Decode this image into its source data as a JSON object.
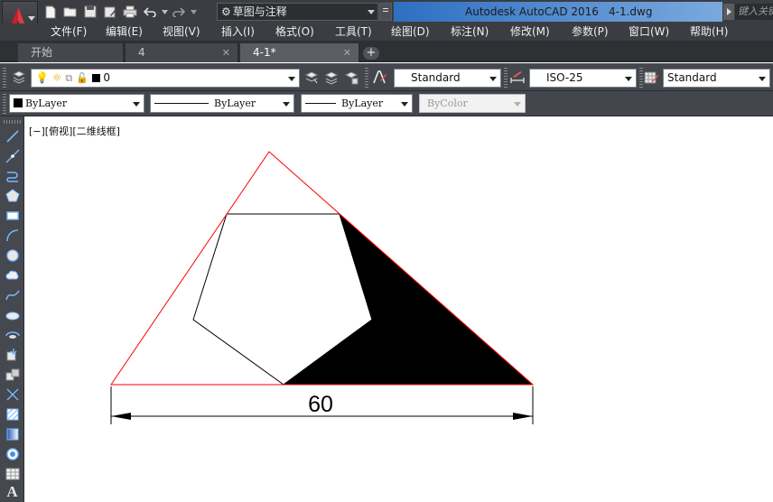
{
  "titlebar": {
    "app_button_icon": "autocad-logo-icon",
    "quick_access": [
      "new-file-icon",
      "open-folder-icon",
      "save-icon",
      "save-as-icon",
      "print-icon",
      "undo-icon",
      "redo-icon"
    ],
    "workspace_label": "草图与注释",
    "app_name": "Autodesk AutoCAD 2016",
    "file_name": "4-1.dwg",
    "search_placeholder": "键入关键字"
  },
  "menubar": {
    "items": [
      "文件(F)",
      "编辑(E)",
      "视图(V)",
      "插入(I)",
      "格式(O)",
      "工具(T)",
      "绘图(D)",
      "标注(N)",
      "修改(M)",
      "参数(P)",
      "窗口(W)",
      "帮助(H)"
    ]
  },
  "tabs": [
    {
      "label": "开始",
      "active": false
    },
    {
      "label": "4",
      "active": false
    },
    {
      "label": "4-1*",
      "active": true
    }
  ],
  "tab_add_label": "+",
  "layer_toolbar": {
    "layer_value": "0",
    "text_style": "Standard",
    "dim_style": "ISO-25",
    "table_style": "Standard"
  },
  "properties_toolbar": {
    "color": "ByLayer",
    "linetype": "ByLayer",
    "lineweight": "ByLayer",
    "plot_style": "ByColor"
  },
  "left_tools": [
    "line-icon",
    "construction-line-icon",
    "polyline-icon",
    "polygon-icon",
    "rectangle-icon",
    "arc-icon",
    "circle-icon",
    "revision-cloud-icon",
    "spline-icon",
    "ellipse-icon",
    "ellipse-arc-icon",
    "insert-block-icon",
    "make-block-icon",
    "point-icon",
    "hatch-icon",
    "gradient-icon",
    "region-icon",
    "table-icon",
    "multiline-text-icon"
  ],
  "canvas": {
    "viewport_label": "[−][俯视][二维线框]",
    "dimension_text": "60"
  },
  "colors": {
    "titlebar_bg": "#3b3d42",
    "title_highlight": "#2d6fc1",
    "triangle_stroke": "#ff0000",
    "pentagon_stroke": "#000000",
    "fill": "#000000"
  }
}
